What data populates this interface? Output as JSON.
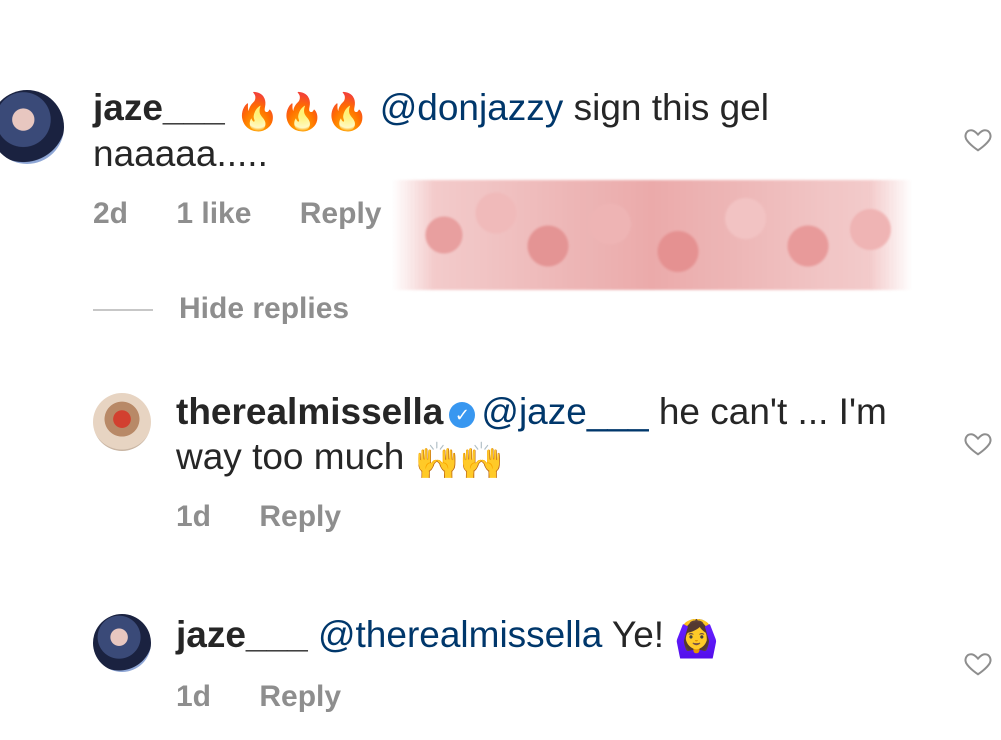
{
  "comments": [
    {
      "username": "jaze___",
      "emojis": "🔥🔥🔥",
      "mention": "@donjazzy",
      "text_line1_rest": " sign this gel",
      "text_line2": "naaaaa.....",
      "time": "2d",
      "likes": "1 like",
      "reply": "Reply",
      "avatar_icon": "profile-photo-jaze",
      "like_icon": "heart-outline-icon"
    },
    {
      "username": "therealmissella",
      "verified_icon": "verified-badge-icon",
      "mention": "@jaze___",
      "text_line1_rest": " he can't ... I'm",
      "text_line2": "way too much",
      "emojis": "🙌🙌",
      "time": "1d",
      "reply": "Reply",
      "avatar_icon": "profile-photo-therealmissella",
      "like_icon": "heart-outline-icon"
    },
    {
      "username": "jaze___",
      "mention": "@therealmissella",
      "text_rest": " Ye!",
      "emojis": "🙆‍♀️",
      "time": "1d",
      "reply": "Reply",
      "avatar_icon": "profile-photo-jaze",
      "like_icon": "heart-outline-icon"
    }
  ],
  "hide_replies": "Hide replies",
  "colors": {
    "text": "#262626",
    "mention": "#00376b",
    "meta": "#8e8e8e",
    "verified": "#3897f0",
    "redaction": "#e79a9a"
  }
}
